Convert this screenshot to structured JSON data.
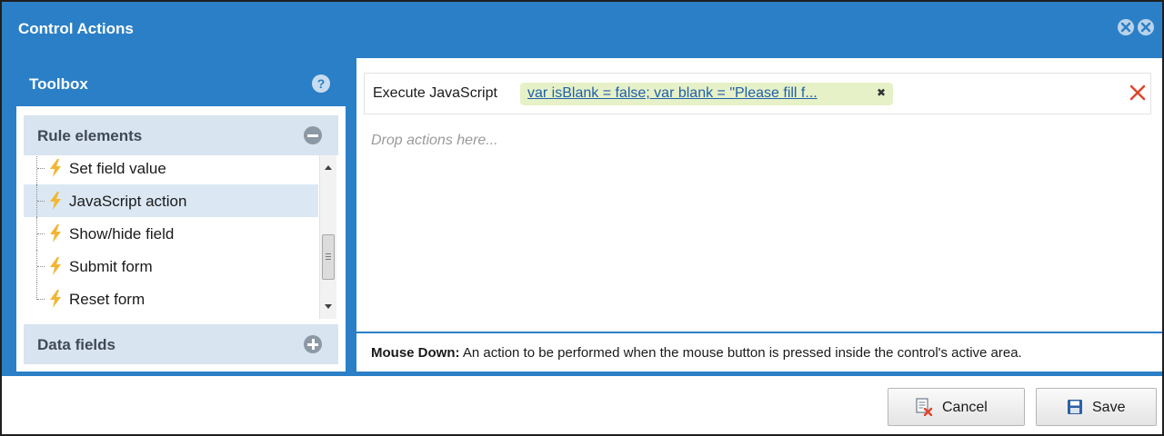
{
  "window": {
    "title": "Control Actions"
  },
  "toolbox": {
    "title": "Toolbox",
    "help_glyph": "?",
    "sections": {
      "rule_elements": "Rule elements",
      "data_fields": "Data fields"
    },
    "items": [
      {
        "label": "Set field value",
        "selected": false
      },
      {
        "label": "JavaScript action",
        "selected": true
      },
      {
        "label": "Show/hide field",
        "selected": false
      },
      {
        "label": "Submit form",
        "selected": false
      },
      {
        "label": "Reset form",
        "selected": false
      }
    ]
  },
  "actions": {
    "action_label": "Execute JavaScript",
    "action_value": "var isBlank = false; var blank = \"Please fill f...",
    "remove_glyph": "✖",
    "drop_hint": "Drop actions here...",
    "event_name": "Mouse Down:",
    "event_description": "An action to be performed when the mouse button is pressed inside the control's active area."
  },
  "buttons": {
    "cancel": "Cancel",
    "save": "Save"
  },
  "colors": {
    "header_blue": "#2b7fc6",
    "section_bg": "#d8e4f0",
    "selected_row": "#dbe8f4",
    "chip_bg": "#e6f1c8",
    "link": "#1f5fa8",
    "delete_red": "#e0442a",
    "bolt": "#f2b632"
  }
}
